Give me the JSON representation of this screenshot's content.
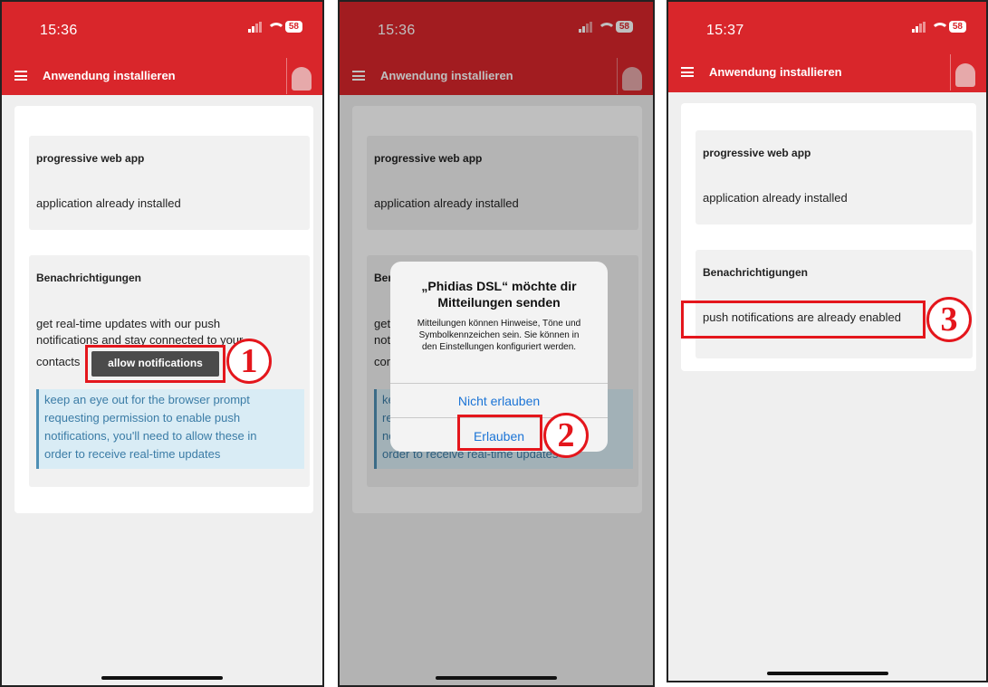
{
  "screens": [
    {
      "time": "15:36",
      "battery": "58",
      "app_title": "Anwendung installieren",
      "card1": {
        "title": "progressive web app",
        "text": "application already installed"
      },
      "card2": {
        "title": "Benachrichtigungen",
        "text_line1": "get real-time updates with our push",
        "text_line2": "notifications and stay connected to your",
        "text_line3": "contacts",
        "button": "allow notifications",
        "info_line1": "keep an eye out for the browser prompt",
        "info_line2": "requesting permission to enable push",
        "info_line3": "notifications, you'll need to allow these in",
        "info_line4": "order to receive real-time updates"
      },
      "step": "1"
    },
    {
      "time": "15:36",
      "battery": "58",
      "app_title": "Anwendung installieren",
      "card1": {
        "title": "progressive web app",
        "text": "application already installed"
      },
      "card2": {
        "title": "Benc",
        "text_a": "get r",
        "text_b": "notif",
        "text_c": "cont",
        "info_a": "kee",
        "info_b": "req",
        "info_c": "not",
        "info_d": "order to receive real-time updates"
      },
      "dialog": {
        "title": "„Phidias DSL“ möchte dir Mitteilungen senden",
        "message": "Mitteilungen können Hinweise, Töne und Symbolkennzeichen sein. Sie können in den Einstellungen konfiguriert werden.",
        "deny": "Nicht erlauben",
        "allow": "Erlauben"
      },
      "step": "2"
    },
    {
      "time": "15:37",
      "battery": "58",
      "app_title": "Anwendung installieren",
      "card1": {
        "title": "progressive web app",
        "text": "application already installed"
      },
      "card2": {
        "title": "Benachrichtigungen",
        "text": "push notifications are already enabled"
      },
      "step": "3"
    }
  ],
  "colors": {
    "header": "#d9262b",
    "annotation": "#e4161c",
    "info_bg": "#d9ecf5",
    "link": "#1b74d6"
  }
}
